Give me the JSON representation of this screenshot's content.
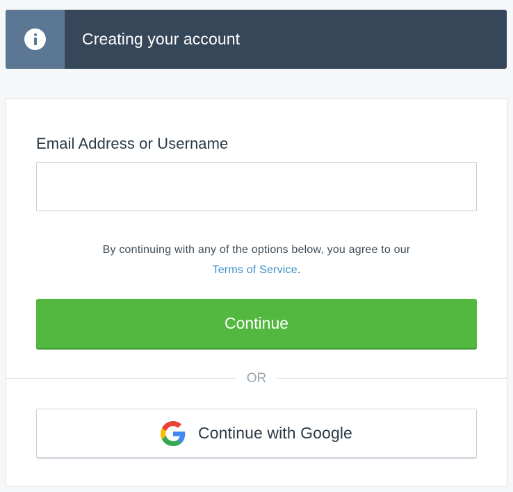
{
  "banner": {
    "icon": "info-icon",
    "message": "Creating your account"
  },
  "form": {
    "email_label": "Email Address or Username",
    "email_value": "",
    "email_placeholder": ""
  },
  "terms": {
    "text": "By continuing with any of the options below, you agree to our",
    "link_label": "Terms of Service",
    "suffix": "."
  },
  "buttons": {
    "continue_label": "Continue",
    "divider_label": "OR",
    "google_label": "Continue with Google",
    "google_icon": "google-icon"
  },
  "colors": {
    "banner_background": "#37475a",
    "banner_icon_background": "#5b7793",
    "primary_green": "#52b83f",
    "link_blue": "#3b8fc4",
    "google_blue": "#4285F4",
    "google_red": "#EA4335",
    "google_yellow": "#FBBC05",
    "google_green": "#34A853"
  }
}
